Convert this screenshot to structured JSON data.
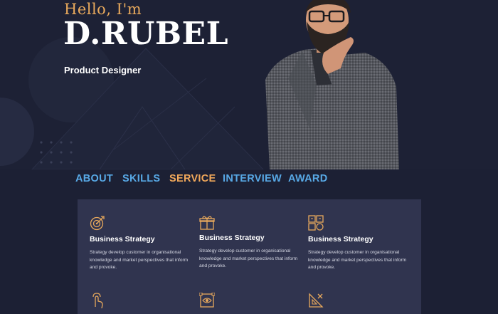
{
  "hero": {
    "greeting": "Hello, I'm",
    "name": "D.RUBEL",
    "role": "Product Designer"
  },
  "nav": {
    "items": [
      {
        "label": "ABOUT",
        "active": false
      },
      {
        "label": "SKILLS",
        "active": false
      },
      {
        "label": "SERVICE",
        "active": true
      },
      {
        "label": "INTERVIEW",
        "active": false
      },
      {
        "label": "AWARD",
        "active": false
      }
    ]
  },
  "services": {
    "cards": [
      {
        "icon": "target-icon",
        "title": "Business Strategy",
        "text": "Strategy develop customer in organisational knowledge and market perspectives that inform and provoke."
      },
      {
        "icon": "gift-box-icon",
        "title": "Business Strategy",
        "text": "Strategy develop customer in organisational knowledge and market perspectives that inform and provoke."
      },
      {
        "icon": "puzzle-icon",
        "title": "Business Strategy",
        "text": "Strategy develop customer in organisational knowledge and market perspectives that inform and provoke."
      }
    ],
    "row2_icons": [
      "touch-hand-icon",
      "eye-frame-icon",
      "design-tools-icon"
    ]
  },
  "colors": {
    "background": "#1c2034",
    "panel": "#30344f",
    "accent": "#f2a95b",
    "nav": "#58a9e6"
  }
}
